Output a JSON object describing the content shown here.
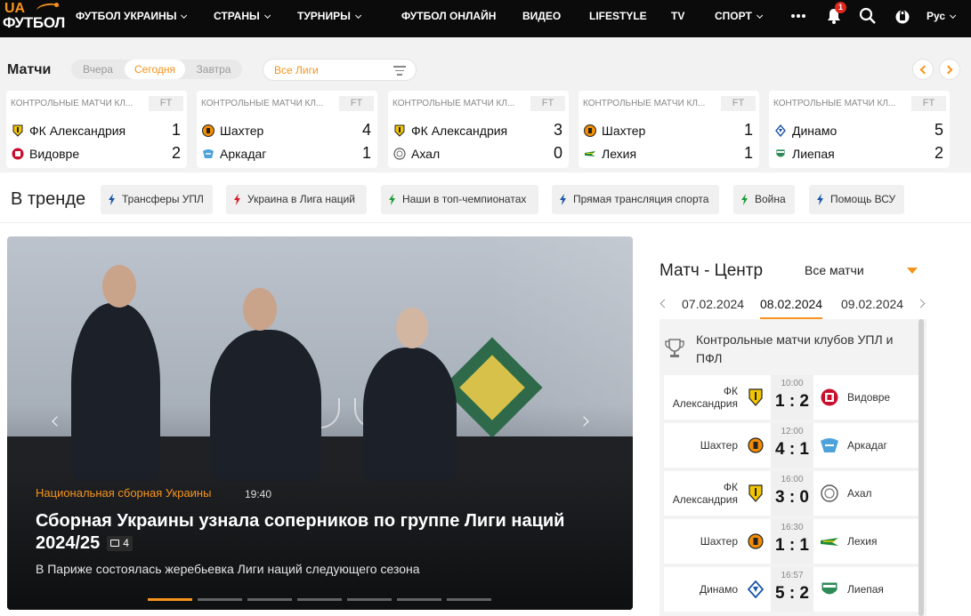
{
  "nav": {
    "logo_top": "UA",
    "logo_bottom": "ФУТБОЛ",
    "items": [
      "ФУТБОЛ УКРАИНЫ",
      "СТРАНЫ",
      "ТУРНИРЫ",
      "ФУТБОЛ ОНЛАЙН",
      "ВИДЕО",
      "LIFESTYLE",
      "TV",
      "СПОРТ"
    ],
    "notifications_count": "1",
    "language": "Рус"
  },
  "matches": {
    "title": "Матчи",
    "day_tabs": [
      "Вчера",
      "Сегодня",
      "Завтра"
    ],
    "league_filter": "Все Лиги",
    "cards": [
      {
        "competition": "КОНТРОЛЬНЫЕ МАТЧИ КЛ...",
        "status": "FT",
        "home": "ФК Александрия",
        "home_score": "1",
        "away": "Видовре",
        "away_score": "2"
      },
      {
        "competition": "КОНТРОЛЬНЫЕ МАТЧИ КЛ...",
        "status": "FT",
        "home": "Шахтер",
        "home_score": "4",
        "away": "Аркадаг",
        "away_score": "1"
      },
      {
        "competition": "КОНТРОЛЬНЫЕ МАТЧИ КЛ...",
        "status": "FT",
        "home": "ФК Александрия",
        "home_score": "3",
        "away": "Ахал",
        "away_score": "0"
      },
      {
        "competition": "КОНТРОЛЬНЫЕ МАТЧИ КЛ...",
        "status": "FT",
        "home": "Шахтер",
        "home_score": "1",
        "away": "Лехия",
        "away_score": "1"
      },
      {
        "competition": "КОНТРОЛЬНЫЕ МАТЧИ КЛ...",
        "status": "FT",
        "home": "Динамо",
        "home_score": "5",
        "away": "Лиепая",
        "away_score": "2"
      }
    ]
  },
  "trending": {
    "title": "В тренде",
    "tags": [
      "Трансферы УПЛ",
      "Украина в Лига наций",
      "Наши в топ-чемпионатах",
      "Прямая трансляция спорта",
      "Война",
      "Помощь ВСУ"
    ]
  },
  "hero": {
    "category": "Национальная сборная Украины",
    "time": "19:40",
    "headline": "Сборная Украины узнала соперников по группе Лиги наций 2024/25",
    "comments": "4",
    "lead": "В Париже состоялась жеребьевка Лиги наций следующего сезона",
    "slides_total": 7,
    "slide_active": 1
  },
  "match_center": {
    "title": "Матч - Центр",
    "filter": "Все матчи",
    "dates": [
      "07.02.2024",
      "08.02.2024",
      "09.02.2024"
    ],
    "active_date": "08.02.2024",
    "competition": "Контрольные матчи клубов УПЛ и ПФЛ",
    "rows": [
      {
        "home": "ФК Александрия",
        "time": "10:00",
        "score": "1 : 2",
        "away": "Видовре"
      },
      {
        "home": "Шахтер",
        "time": "12:00",
        "score": "4 : 1",
        "away": "Аркадаг"
      },
      {
        "home": "ФК Александрия",
        "time": "16:00",
        "score": "3 : 0",
        "away": "Ахал"
      },
      {
        "home": "Шахтер",
        "time": "16:30",
        "score": "1 : 1",
        "away": "Лехия"
      },
      {
        "home": "Динамо",
        "time": "16:57",
        "score": "5 : 2",
        "away": "Лиепая"
      }
    ]
  },
  "colors": {
    "accent": "#f7941d",
    "nav_bg": "#0b0b0b",
    "badge": "#e0281e"
  }
}
